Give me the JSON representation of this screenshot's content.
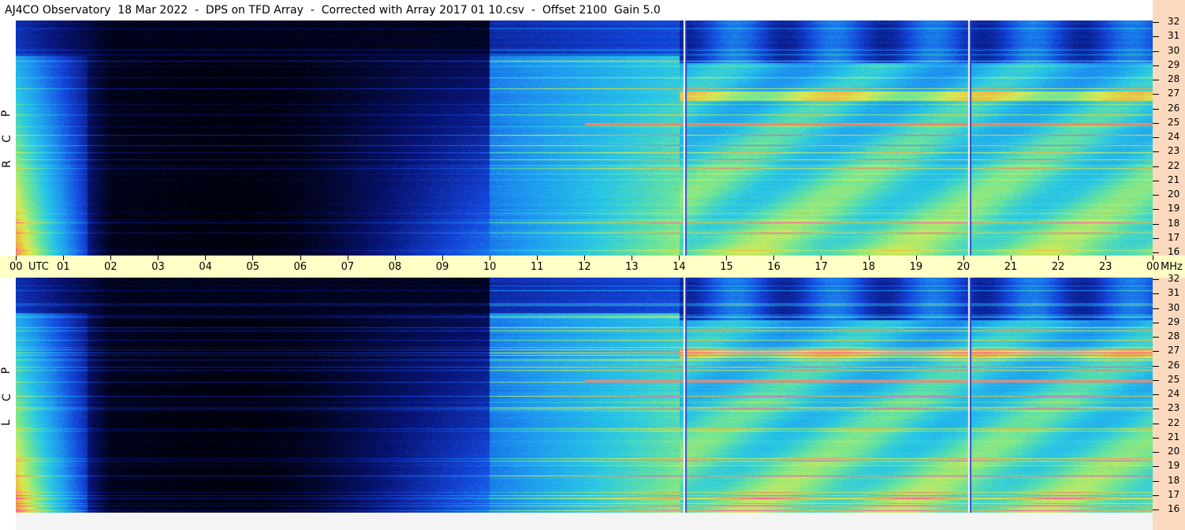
{
  "title": "AJ4CO Observatory  18 Mar 2022  -  DPS on TFD Array  -  Corrected with Array 2017 01 10.csv  -  Offset 2100  Gain 5.0",
  "chart_data": [
    {
      "type": "heatmap",
      "panel": "top",
      "polarization_letters": [
        "R",
        "C",
        "P"
      ],
      "x_axis": {
        "unit": "UTC",
        "range": [
          0,
          24
        ]
      },
      "y_axis": {
        "unit": "MHz",
        "range": [
          16,
          32
        ],
        "ticks": [
          16,
          17,
          18,
          19,
          20,
          21,
          22,
          23,
          24,
          25,
          26,
          27,
          28,
          29,
          30,
          31,
          32
        ]
      },
      "colorscale": [
        "#000000",
        "#0a1e8c",
        "#1a56e6",
        "#28c8f0",
        "#6ee6a0",
        "#e6f050",
        "#f0a040",
        "#ff40c0"
      ]
    },
    {
      "type": "heatmap",
      "panel": "bottom",
      "polarization_letters": [
        "L",
        "C",
        "P"
      ],
      "x_axis": {
        "unit": "UTC",
        "range": [
          0,
          24
        ]
      },
      "y_axis": {
        "unit": "MHz",
        "range": [
          16,
          32
        ],
        "ticks": [
          16,
          17,
          18,
          19,
          20,
          21,
          22,
          23,
          24,
          25,
          26,
          27,
          28,
          29,
          30,
          31,
          32
        ]
      },
      "colorscale": [
        "#000000",
        "#0a1e8c",
        "#1a56e6",
        "#28c8f0",
        "#6ee6a0",
        "#e6f050",
        "#f0a040",
        "#ff40c0"
      ]
    }
  ],
  "time_axis": {
    "ticks": [
      "00",
      "01",
      "02",
      "03",
      "04",
      "05",
      "06",
      "07",
      "08",
      "09",
      "10",
      "11",
      "12",
      "13",
      "14",
      "15",
      "16",
      "17",
      "18",
      "19",
      "20",
      "21",
      "22",
      "23",
      "00"
    ],
    "utc_label": "UTC",
    "mhz_label": "MHz"
  },
  "freq_ticks": [
    "32",
    "31",
    "30",
    "29",
    "28",
    "27",
    "26",
    "25",
    "24",
    "23",
    "22",
    "21",
    "20",
    "19",
    "18",
    "17",
    "16"
  ],
  "colors": {
    "title_bg": "#ffffff",
    "axis_bg": "#ffffc6",
    "right_strip": "#fbd9bf"
  }
}
